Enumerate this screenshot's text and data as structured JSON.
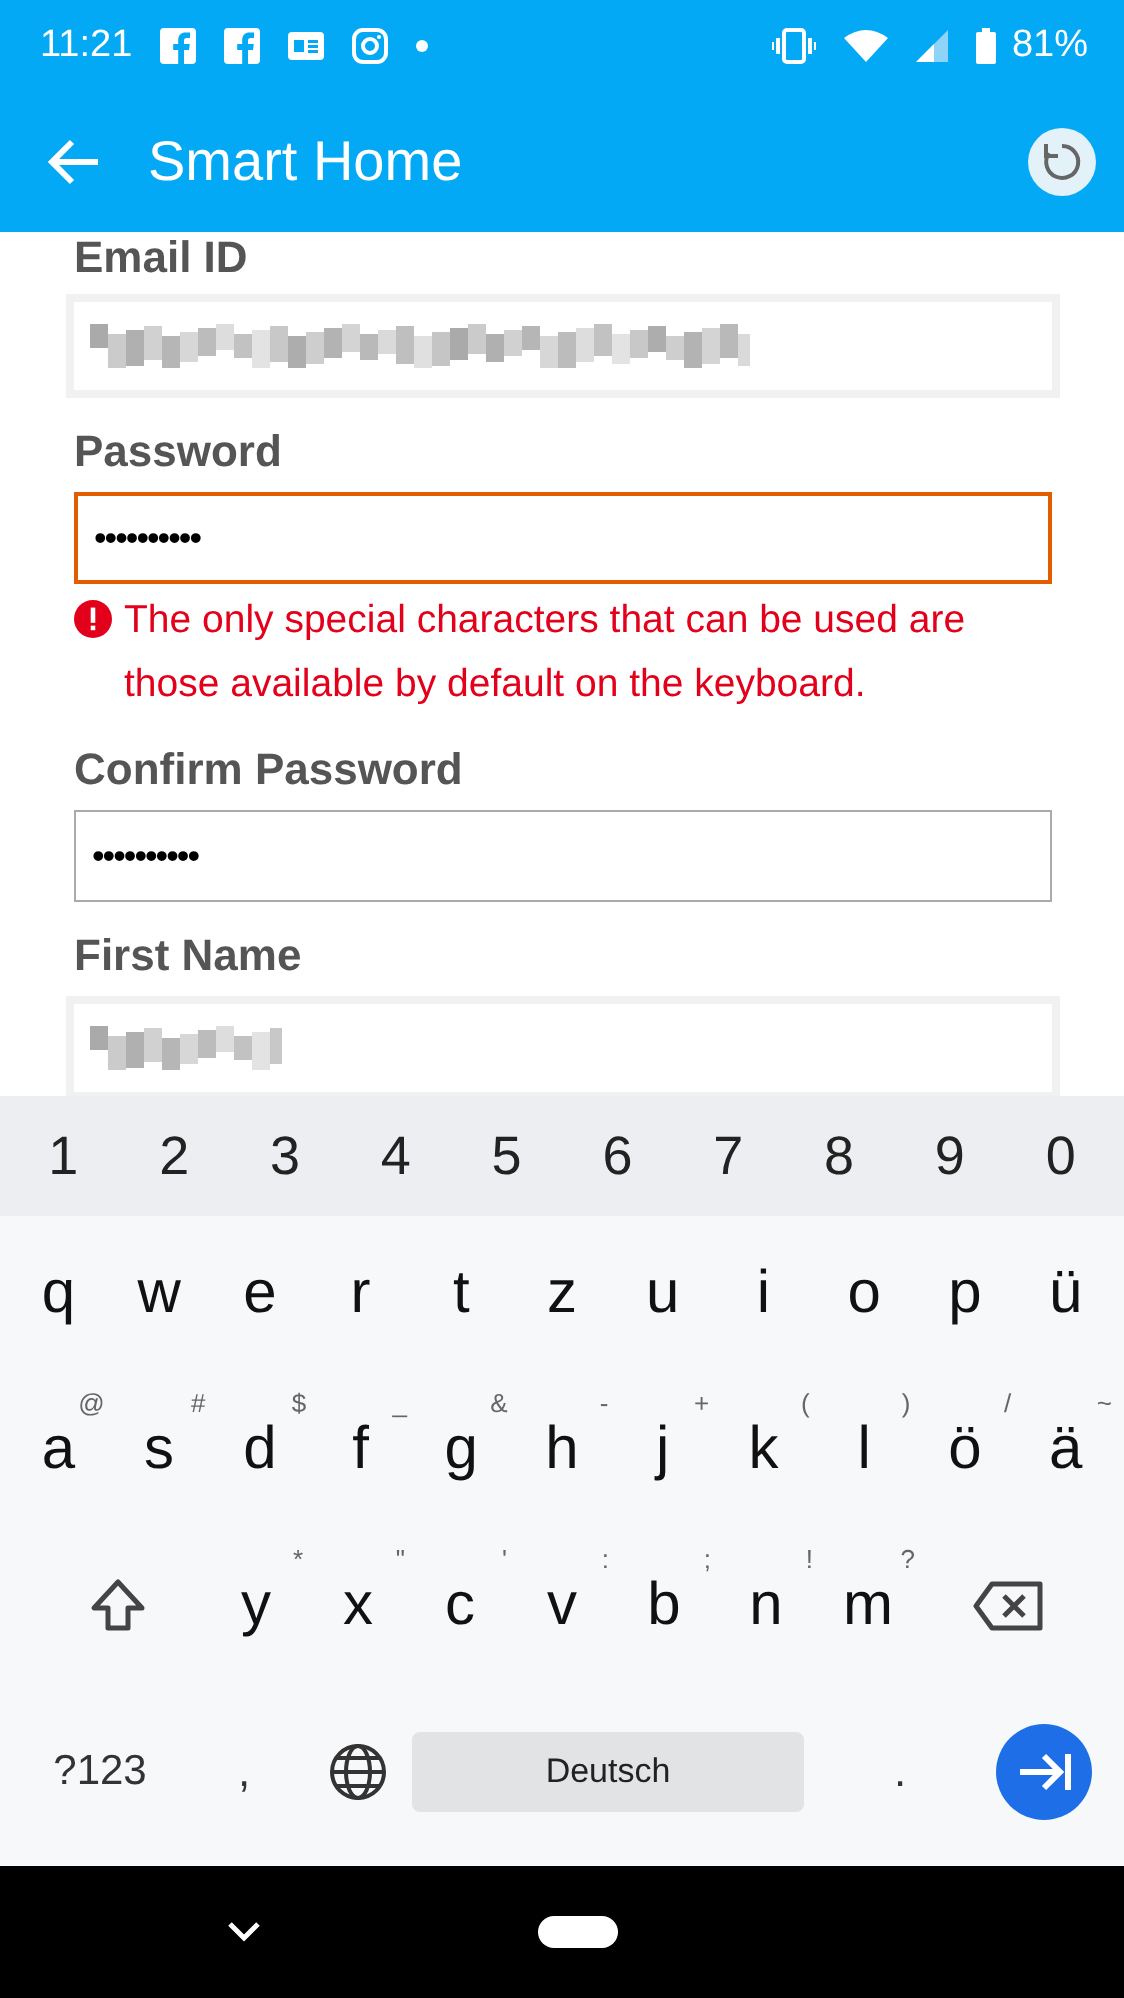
{
  "status_bar": {
    "time": "11:21",
    "battery_text": "81%"
  },
  "header": {
    "title": "Smart Home"
  },
  "form": {
    "fields": [
      {
        "label": "Email ID",
        "kind": "redacted",
        "invalid": false
      },
      {
        "label": "Password",
        "kind": "password",
        "value": "••••••••••",
        "invalid": true,
        "error": "The only special characters that can be used are those available by default on the keyboard."
      },
      {
        "label": "Confirm Password",
        "kind": "password",
        "value": "••••••••••",
        "invalid": false
      },
      {
        "label": "First Name",
        "kind": "redacted",
        "invalid": false
      }
    ]
  },
  "keyboard": {
    "number_row": [
      "1",
      "2",
      "3",
      "4",
      "5",
      "6",
      "7",
      "8",
      "9",
      "0"
    ],
    "letter_rows": [
      [
        {
          "label": "q"
        },
        {
          "label": "w"
        },
        {
          "label": "e"
        },
        {
          "label": "r"
        },
        {
          "label": "t"
        },
        {
          "label": "z"
        },
        {
          "label": "u"
        },
        {
          "label": "i"
        },
        {
          "label": "o"
        },
        {
          "label": "p"
        },
        {
          "label": "ü"
        }
      ],
      [
        {
          "label": "a",
          "hint": "@"
        },
        {
          "label": "s",
          "hint": "#"
        },
        {
          "label": "d",
          "hint": "$"
        },
        {
          "label": "f",
          "hint": "_"
        },
        {
          "label": "g",
          "hint": "&"
        },
        {
          "label": "h",
          "hint": "-"
        },
        {
          "label": "j",
          "hint": "+"
        },
        {
          "label": "k",
          "hint": "("
        },
        {
          "label": "l",
          "hint": ")"
        },
        {
          "label": "ö",
          "hint": "/"
        },
        {
          "label": "ä",
          "hint": "~"
        }
      ]
    ],
    "shift_row_keys": [
      {
        "label": "y",
        "hint": "*"
      },
      {
        "label": "x",
        "hint": "\""
      },
      {
        "label": "c",
        "hint": "'"
      },
      {
        "label": "v",
        "hint": ":"
      },
      {
        "label": "b",
        "hint": ";"
      },
      {
        "label": "n",
        "hint": "!"
      },
      {
        "label": "m",
        "hint": "?"
      }
    ],
    "symbols_key": "?123",
    "comma_key": ",",
    "space_key": "Deutsch",
    "period_key": "."
  }
}
